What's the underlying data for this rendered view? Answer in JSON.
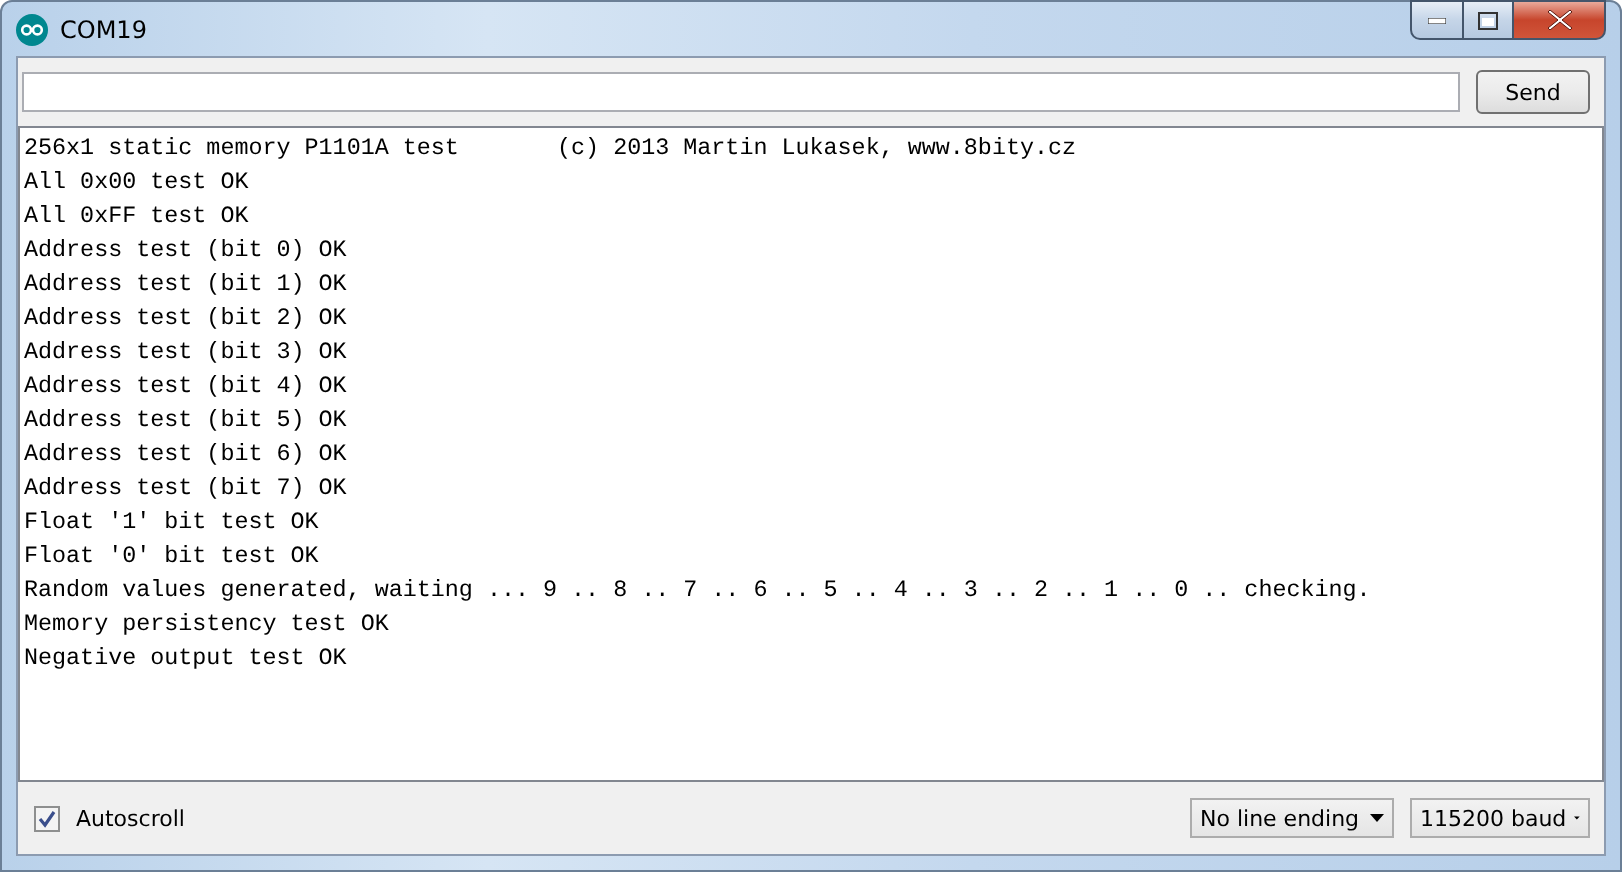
{
  "window": {
    "title": "COM19"
  },
  "send_button": "Send",
  "output_lines": [
    "256x1 static memory P1101A test       (c) 2013 Martin Lukasek, www.8bity.cz",
    "All 0x00 test OK",
    "All 0xFF test OK",
    "Address test (bit 0) OK",
    "Address test (bit 1) OK",
    "Address test (bit 2) OK",
    "Address test (bit 3) OK",
    "Address test (bit 4) OK",
    "Address test (bit 5) OK",
    "Address test (bit 6) OK",
    "Address test (bit 7) OK",
    "Float '1' bit test OK",
    "Float '0' bit test OK",
    "Random values generated, waiting ... 9 .. 8 .. 7 .. 6 .. 5 .. 4 .. 3 .. 2 .. 1 .. 0 .. checking.",
    "Memory persistency test OK",
    "Negative output test OK"
  ],
  "autoscroll": {
    "label": "Autoscroll",
    "checked": true
  },
  "line_ending": "No line ending",
  "baud": "115200 baud"
}
